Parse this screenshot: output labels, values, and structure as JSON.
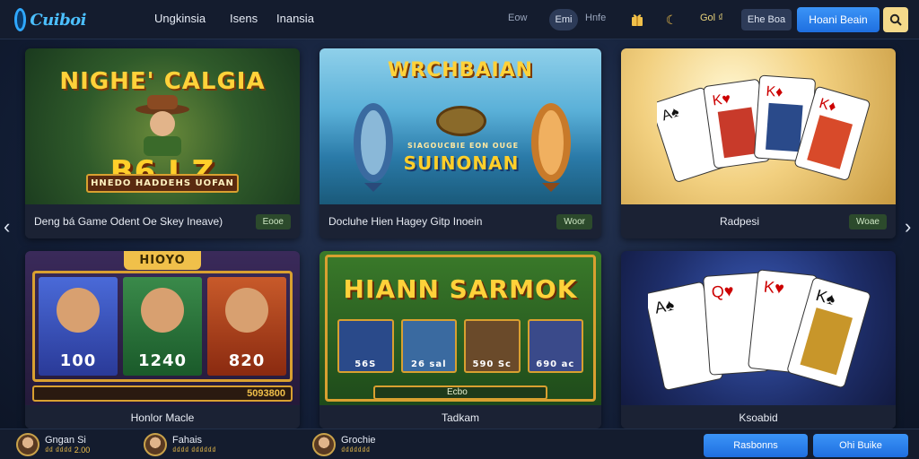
{
  "header": {
    "logo_text": "Cuiboi",
    "nav": [
      "Ungkinsia",
      "Isens",
      "Inansia"
    ],
    "right_text_1": "Eow",
    "pill_label": "Emi",
    "right_text_2": "Hnfe",
    "gift_icon": "gift-icon",
    "coin_text": "Gol ₫",
    "pill_2_label": "Ehe Boa",
    "cta_label": "Hoani Beain",
    "search_icon": "search-icon"
  },
  "cards": [
    {
      "art_title": "NIGHE' CALGIA",
      "art_numbers": "B6 I Z",
      "art_sub": "HNEDO HADDEHS UOFAN",
      "title": "Deng bá Game Odent Oe Skey Ineave)",
      "tag": "Eooe"
    },
    {
      "art_title": "WRCHBAIAN",
      "art_sub_1": "SIAGOUCBIE EON OUGE",
      "art_sub_2": "SUINONAN",
      "title": "Docluhe Hien Hagey Gitp Inoein",
      "tag": "Woor"
    },
    {
      "title": "Radpesi",
      "tag": "Woae"
    },
    {
      "art_banner": "HIOYO",
      "slots": [
        "100",
        "1240",
        "820"
      ],
      "bar_text": "5093800",
      "title": "Honlor Macle"
    },
    {
      "art_title": "HIANN SARMOK",
      "slot_labels": [
        "56S",
        "26 sal",
        "590 Sc",
        "690 ac"
      ],
      "bar_text": "Ecbo",
      "title": "Tadkam"
    },
    {
      "title": "Ksoabid"
    }
  ],
  "footer": {
    "players": [
      {
        "name": "Gngan Si",
        "sub": "₫₫ ₫₫₫₫ 2.00"
      },
      {
        "name": "Fahais",
        "sub": "₫₫₫₫ ₫₫₫₫₫₫"
      },
      {
        "name": "Grochie",
        "sub": "₫₫₫₫₫₫₫"
      }
    ],
    "btn_1": "Rasbonns",
    "btn_2": "Ohi Buike"
  },
  "colors": {
    "accent_blue": "#1f6fe0",
    "gold": "#f0c04a",
    "tag_green": "#2c4a2c"
  }
}
